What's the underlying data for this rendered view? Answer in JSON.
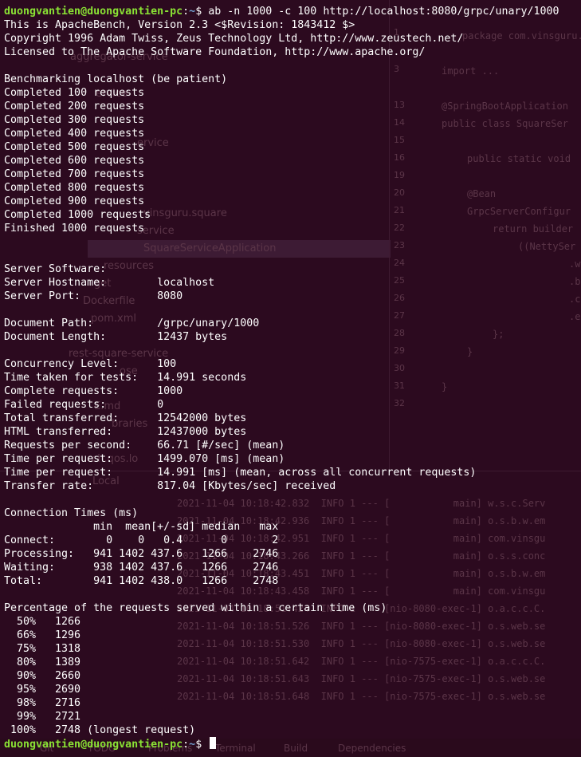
{
  "prompt": {
    "user_host": "duongvantien@duongvantien-pc",
    "path": "~",
    "symbol": "$"
  },
  "command": "ab -n 1000 -c 100 http://localhost:8080/grpc/unary/1000",
  "header": [
    "This is ApacheBench, Version 2.3 <$Revision: 1843412 $>",
    "Copyright 1996 Adam Twiss, Zeus Technology Ltd, http://www.zeustech.net/",
    "Licensed to The Apache Software Foundation, http://www.apache.org/"
  ],
  "benchmarking": "Benchmarking localhost (be patient)",
  "progress": [
    "Completed 100 requests",
    "Completed 200 requests",
    "Completed 300 requests",
    "Completed 400 requests",
    "Completed 500 requests",
    "Completed 600 requests",
    "Completed 700 requests",
    "Completed 800 requests",
    "Completed 900 requests",
    "Completed 1000 requests",
    "Finished 1000 requests"
  ],
  "server": [
    "Server Software:",
    "Server Hostname:        localhost",
    "Server Port:            8080"
  ],
  "document": [
    "Document Path:          /grpc/unary/1000",
    "Document Length:        12437 bytes"
  ],
  "stats": [
    "Concurrency Level:      100",
    "Time taken for tests:   14.991 seconds",
    "Complete requests:      1000",
    "Failed requests:        0",
    "Total transferred:      12542000 bytes",
    "HTML transferred:       12437000 bytes",
    "Requests per second:    66.71 [#/sec] (mean)",
    "Time per request:       1499.070 [ms] (mean)",
    "Time per request:       14.991 [ms] (mean, across all concurrent requests)",
    "Transfer rate:          817.04 [Kbytes/sec] received"
  ],
  "connection_times": [
    "Connection Times (ms)",
    "              min  mean[+/-sd] median   max",
    "Connect:        0    0   0.4      0       2",
    "Processing:   941 1402 437.6   1266    2746",
    "Waiting:      938 1402 437.6   1266    2746",
    "Total:        941 1402 438.0   1266    2748"
  ],
  "percentiles_title": "Percentage of the requests served within a certain time (ms)",
  "percentiles": [
    "  50%   1266",
    "  66%   1296",
    "  75%   1318",
    "  80%   1389",
    "  90%   2660",
    "  95%   2690",
    "  98%   2716",
    "  99%   2721",
    " 100%   2748 (longest request)"
  ],
  "background_ide": {
    "project_items": [
      "aggregator-service",
      "ervice",
      "ervice",
      "vinsguru.square",
      "service",
      "SquareServiceApplication",
      "resources",
      "get",
      "Dockerfile",
      "pom.xml",
      "rest-square-service",
      "ose",
      "E.md",
      "braries",
      "rch.qos.lo",
      "Local"
    ],
    "code_line_numbers": [
      "1",
      "3",
      "13",
      "14",
      "15",
      "16",
      "19",
      "20",
      "21",
      "22",
      "23",
      "24",
      "25",
      "26",
      "27",
      "28",
      "29",
      "30",
      "31",
      "32"
    ],
    "code_text": [
      "package com.vinsguru.s",
      "import ...",
      "@SpringBootApplication",
      "public class SquareSer",
      "public static void",
      "@Bean",
      "GrpcServerConfigur",
      "return builder",
      "((NettySer",
      ".w",
      ".b",
      ".c",
      ".e",
      "};",
      "}",
      "}"
    ],
    "tool_tabs": [
      "Git",
      "TODO",
      "Problems",
      "Terminal",
      "Build",
      "Dependencies"
    ],
    "log_lines": [
      "2021-11-04 10:18:42.832  INFO 1 --- [           main] w.s.c.Serv",
      "2021-11-04 10:18:42.936  INFO 1 --- [           main] o.s.b.w.em",
      "2021-11-04 10:18:42.951  INFO 1 --- [           main] com.vinsgu",
      "2021-11-04 10:18:43.266  INFO 1 --- [           main] o.s.s.conc",
      "2021-11-04 10:18:43.451  INFO 1 --- [           main] o.s.b.w.em",
      "2021-11-04 10:18:43.458  INFO 1 --- [           main] com.vinsgu",
      "2021-11-04 10:18:51.424  INFO 1 --- [nio-8080-exec-1] o.a.c.c.C.",
      "2021-11-04 10:18:51.526  INFO 1 --- [nio-8080-exec-1] o.s.web.se",
      "2021-11-04 10:18:51.530  INFO 1 --- [nio-8080-exec-1] o.s.web.se",
      "2021-11-04 10:18:51.642  INFO 1 --- [nio-7575-exec-1] o.a.c.c.C.",
      "2021-11-04 10:18:51.643  INFO 1 --- [nio-7575-exec-1] o.s.web.se",
      "2021-11-04 10:18:51.648  INFO 1 --- [nio-7575-exec-1] o.s.web.se"
    ]
  }
}
